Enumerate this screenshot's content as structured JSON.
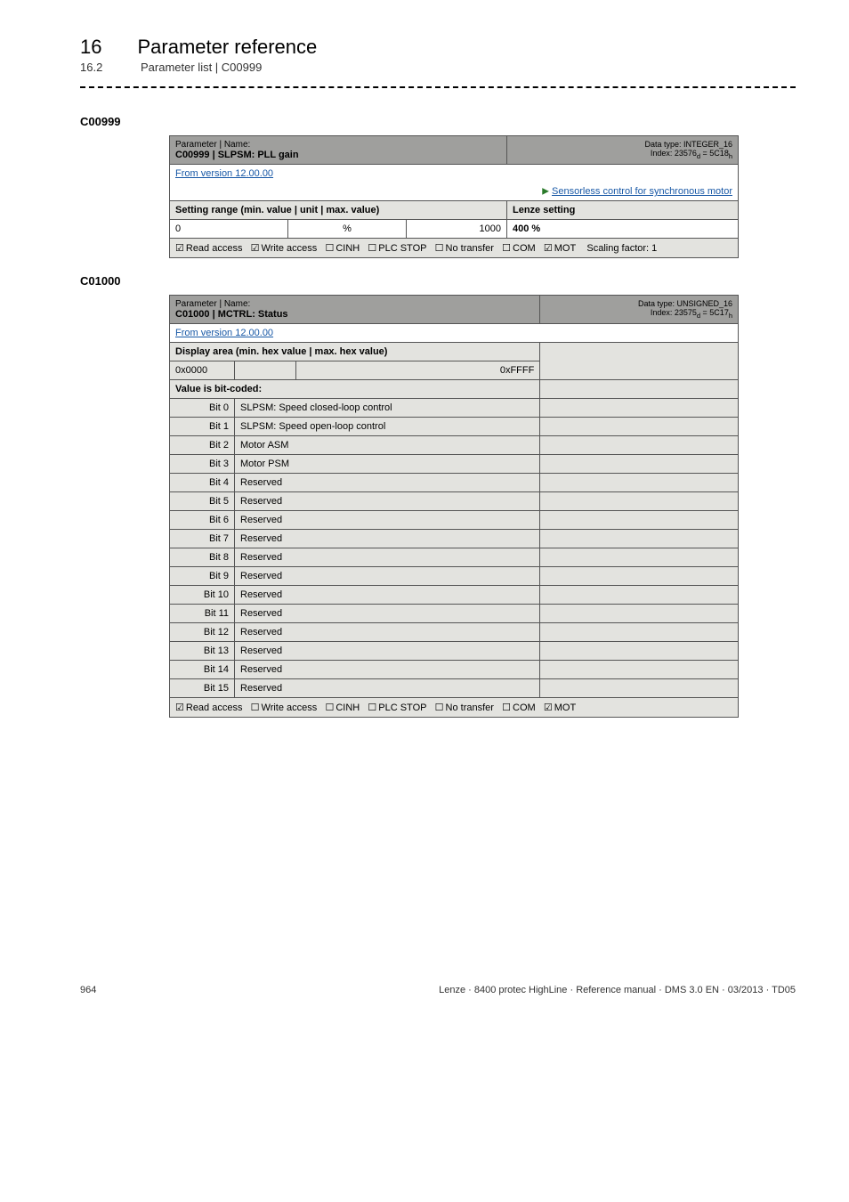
{
  "header": {
    "chapter_num": "16",
    "chapter_title": "Parameter reference",
    "section_num": "16.2",
    "section_title": "Parameter list | C00999"
  },
  "c00999": {
    "code_header": "C00999",
    "param_name_label": "Parameter | Name:",
    "param_code_name": "C00999 | SLPSM: PLL gain",
    "dtype_line1": "Data type: INTEGER_16",
    "dtype_line2": "Index: 23576",
    "dtype_suffix_d": "d",
    "dtype_eq": " = 5C18",
    "dtype_suffix_h": "h",
    "from_version": "From version 12.00.00",
    "crossref": "Sensorless control for synchronous motor",
    "setting_range": "Setting range (min. value | unit | max. value)",
    "lenze_setting": "Lenze setting",
    "min": "0",
    "unit": "%",
    "max": "1000",
    "default": "400 %",
    "access_read": "Read access",
    "access_write": "Write access",
    "access_cinh": "CINH",
    "access_plc": "PLC STOP",
    "access_notransfer": "No transfer",
    "access_com": "COM",
    "access_mot": "MOT",
    "scaling": "Scaling factor: 1"
  },
  "c01000": {
    "code_header": "C01000",
    "param_name_label": "Parameter | Name:",
    "param_code_name": "C01000 | MCTRL: Status",
    "dtype_line1": "Data type: UNSIGNED_16",
    "dtype_line2": "Index: 23575",
    "dtype_suffix_d": "d",
    "dtype_eq": " = 5C17",
    "dtype_suffix_h": "h",
    "from_version": "From version 12.00.00",
    "display_area": "Display area (min. hex value | max. hex value)",
    "hex_min": "0x0000",
    "hex_max": "0xFFFF",
    "value_bit_coded": "Value is bit-coded:",
    "bits": [
      {
        "label": "Bit 0",
        "desc": "SLPSM: Speed closed-loop control"
      },
      {
        "label": "Bit 1",
        "desc": "SLPSM: Speed open-loop control"
      },
      {
        "label": "Bit 2",
        "desc": "Motor ASM"
      },
      {
        "label": "Bit 3",
        "desc": "Motor PSM"
      },
      {
        "label": "Bit 4",
        "desc": "Reserved"
      },
      {
        "label": "Bit 5",
        "desc": "Reserved"
      },
      {
        "label": "Bit 6",
        "desc": "Reserved"
      },
      {
        "label": "Bit 7",
        "desc": "Reserved"
      },
      {
        "label": "Bit 8",
        "desc": "Reserved"
      },
      {
        "label": "Bit 9",
        "desc": "Reserved"
      },
      {
        "label": "Bit 10",
        "desc": "Reserved"
      },
      {
        "label": "Bit 11",
        "desc": "Reserved"
      },
      {
        "label": "Bit 12",
        "desc": "Reserved"
      },
      {
        "label": "Bit 13",
        "desc": "Reserved"
      },
      {
        "label": "Bit 14",
        "desc": "Reserved"
      },
      {
        "label": "Bit 15",
        "desc": "Reserved"
      }
    ],
    "access_read": "Read access",
    "access_write": "Write access",
    "access_cinh": "CINH",
    "access_plc": "PLC STOP",
    "access_notransfer": "No transfer",
    "access_com": "COM",
    "access_mot": "MOT"
  },
  "footer": {
    "page": "964",
    "doc": "Lenze · 8400 protec HighLine · Reference manual · DMS 3.0 EN · 03/2013 · TD05"
  },
  "glyphs": {
    "checked": "☑",
    "unchecked": "☐",
    "arrow": "▶"
  }
}
